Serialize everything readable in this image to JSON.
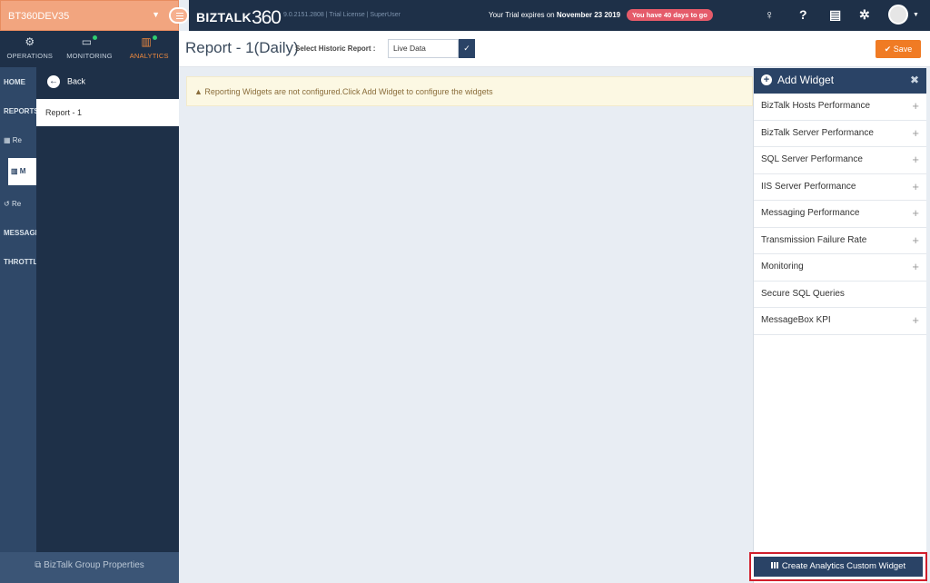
{
  "env": {
    "name": "BT360DEV35"
  },
  "topnav": [
    {
      "label": "OPERATIONS",
      "icon": "gears-icon",
      "active": false
    },
    {
      "label": "MONITORING",
      "icon": "monitor-icon",
      "active": false
    },
    {
      "label": "ANALYTICS",
      "icon": "bar-chart-icon",
      "active": true
    }
  ],
  "sidenav": {
    "home": "HOME",
    "reports": "REPORTS",
    "item1": "Re",
    "item2": "M",
    "item3": "Re",
    "messaging": "MESSAGING",
    "throttling": "THROTTLING"
  },
  "flyout": {
    "back_label": "Back",
    "report_item": "Report - 1"
  },
  "footer": {
    "label": "BizTalk Group Properties"
  },
  "topbar": {
    "brand": "BIZTALK",
    "brand_num": "360",
    "version": "9.0.2151.2808 | Trial License  |  SuperUser",
    "trial_text": "Your Trial expires on ",
    "trial_date": "November 23 2019",
    "trial_badge": "You have 40 days to go"
  },
  "header": {
    "title": "Report - 1(Daily)",
    "historic_label": "Select Historic Report :",
    "historic_value": "Live Data",
    "save_label": "Save"
  },
  "alert": {
    "text": "Reporting Widgets are not configured.Click Add Widget to configure the widgets"
  },
  "panel": {
    "title": "Add Widget",
    "widgets": [
      {
        "label": "BizTalk Hosts Performance",
        "expandable": true
      },
      {
        "label": "BizTalk Server Performance",
        "expandable": true
      },
      {
        "label": "SQL Server Performance",
        "expandable": true
      },
      {
        "label": "IIS Server Performance",
        "expandable": true
      },
      {
        "label": "Messaging Performance",
        "expandable": true
      },
      {
        "label": "Transmission Failure Rate",
        "expandable": true
      },
      {
        "label": "Monitoring",
        "expandable": true
      },
      {
        "label": "Secure SQL Queries",
        "expandable": false
      },
      {
        "label": "MessageBox KPI",
        "expandable": true
      }
    ],
    "create_label": "Create Analytics Custom Widget"
  },
  "colors": {
    "accent_orange": "#f07b24",
    "navy": "#1e3048",
    "highlight_red": "#d11f2c"
  }
}
